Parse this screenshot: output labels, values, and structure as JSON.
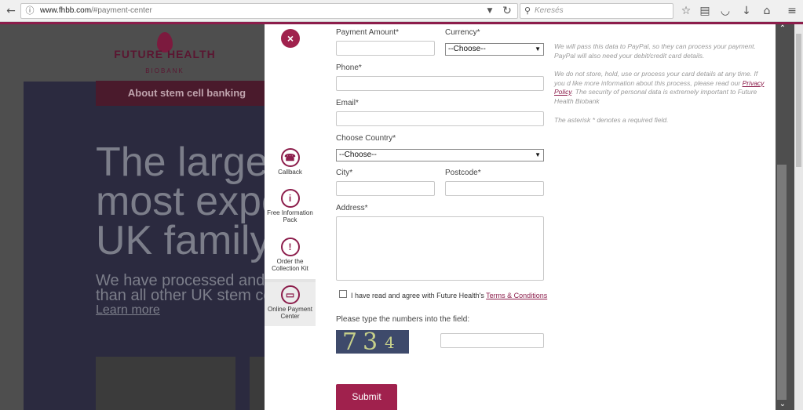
{
  "browser": {
    "url_host": "www.fhbb.com",
    "url_path": "/#payment-center",
    "search_placeholder": "Keresés"
  },
  "site": {
    "logo_line1": "FUTURE HEALTH",
    "logo_line2": "BIOBANK",
    "about_button": "About stem cell banking",
    "hero_lines": [
      "The largest",
      "most exper",
      "UK family b"
    ],
    "sub_lines": [
      "We have processed and sto",
      "than all other UK stem cell b"
    ],
    "learn_more": "Learn more"
  },
  "modal": {
    "close_label": "×",
    "side_nav": [
      {
        "label": "Callback",
        "icon": "☎"
      },
      {
        "label": "Free Information Pack",
        "icon": "i"
      },
      {
        "label": "Order the Collection Kit",
        "icon": "!"
      },
      {
        "label": "Online Payment Center",
        "icon": "▭"
      }
    ],
    "form": {
      "payment_amount_label": "Payment Amount*",
      "currency_label": "Currency*",
      "currency_value": "--Choose--",
      "phone_label": "Phone*",
      "email_label": "Email*",
      "country_label": "Choose Country*",
      "country_value": "--Choose--",
      "city_label": "City*",
      "postcode_label": "Postcode*",
      "address_label": "Address*",
      "terms_prefix": "I have read and agree with Future Health's",
      "terms_link": "Terms & Conditions",
      "captcha_label": "Please type the numbers into the field:",
      "captcha_digits": [
        "7",
        "3",
        "4"
      ],
      "submit_label": "Submit"
    },
    "notes": {
      "paypal": "We will pass this data to PayPal, so they can process your payment. PayPal will also need your debit/credit card details.",
      "privacy_pre": "We do not store, hold, use or process your card details at any time. If you d like more information about this process, please read our",
      "privacy_link": "Privacy Policy",
      "privacy_post": ". The security of personal data is extremely important to Future Health Biobank",
      "asterisk": "The asterisk * denotes a required field."
    }
  }
}
